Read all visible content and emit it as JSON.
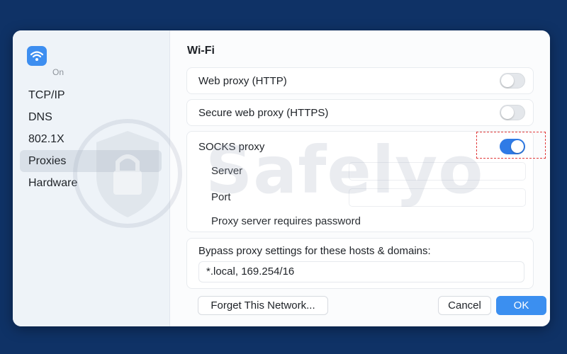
{
  "sidebar": {
    "wifi_status": "On",
    "items": [
      {
        "label": "TCP/IP"
      },
      {
        "label": "DNS"
      },
      {
        "label": "802.1X"
      },
      {
        "label": "Proxies"
      },
      {
        "label": "Hardware"
      }
    ],
    "selected": "Proxies"
  },
  "main": {
    "title": "Wi-Fi",
    "web_proxy": {
      "label": "Web proxy (HTTP)",
      "enabled": false
    },
    "secure_web_proxy": {
      "label": "Secure web proxy (HTTPS)",
      "enabled": false
    },
    "socks_proxy": {
      "label": "SOCKS proxy",
      "enabled": true,
      "server_label": "Server",
      "server_value": "",
      "port_label": "Port",
      "port_value": "",
      "password_label": "Proxy server requires password"
    },
    "bypass": {
      "label": "Bypass proxy settings for these hosts & domains:",
      "value": "*.local, 169.254/16"
    }
  },
  "footer": {
    "forget_label": "Forget This Network...",
    "cancel_label": "Cancel",
    "ok_label": "OK"
  },
  "watermark": {
    "text": "Safelyo"
  },
  "colors": {
    "background": "#0f3266",
    "accent": "#3b8ff0",
    "toggle_on": "#2f7be6",
    "highlight": "#e23b3b"
  }
}
